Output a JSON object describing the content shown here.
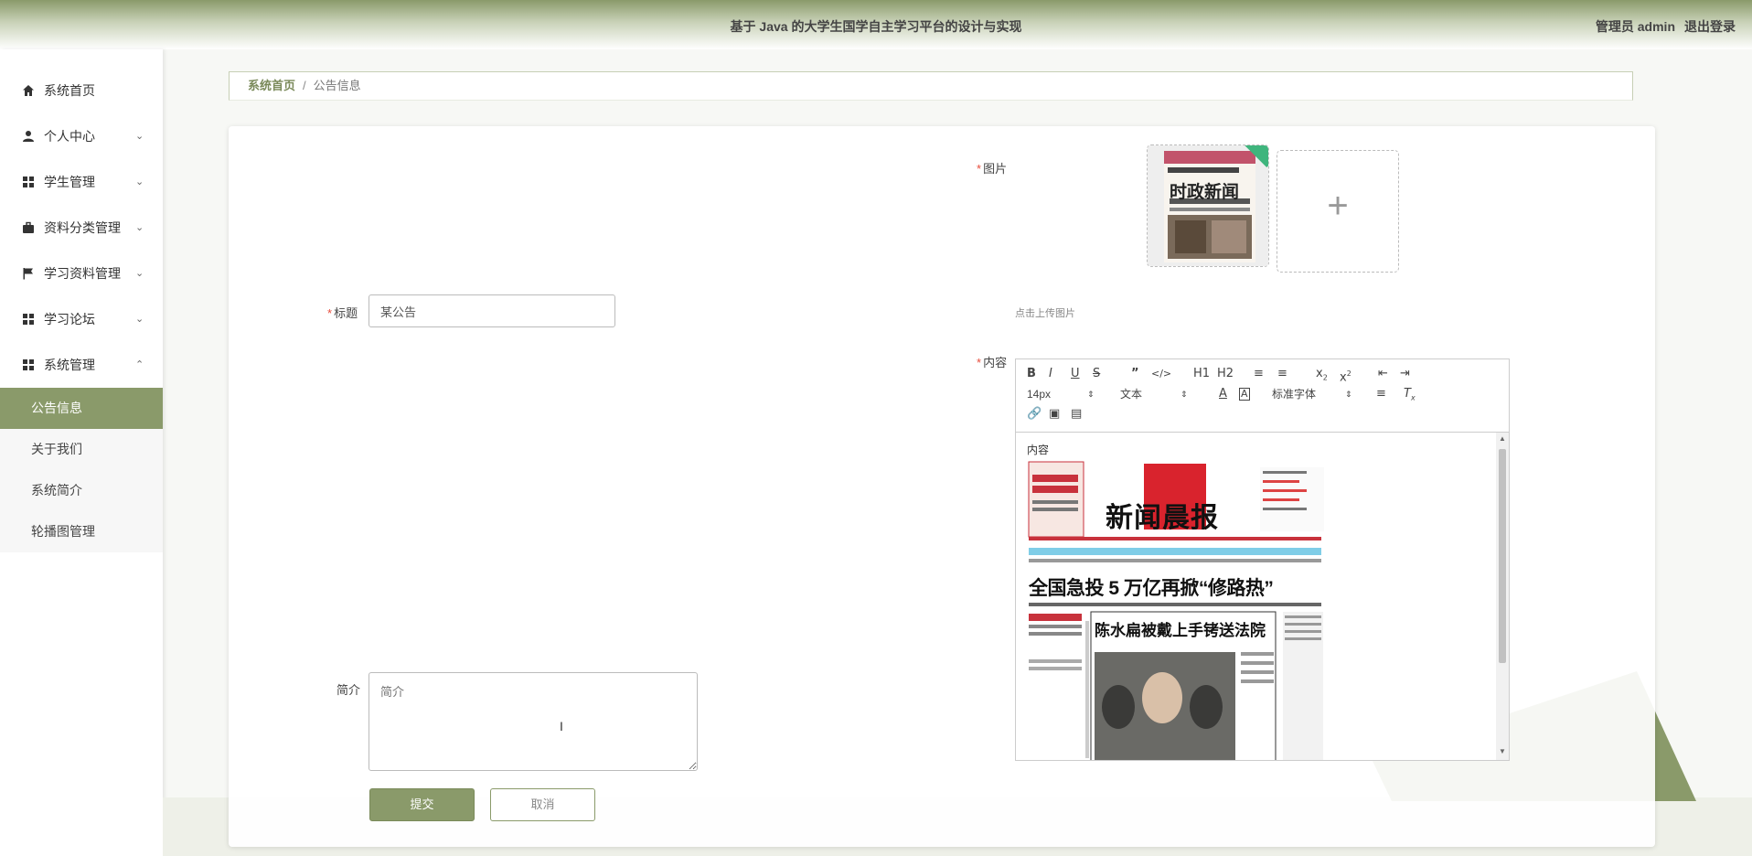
{
  "header": {
    "title": "基于 Java 的大学生国学自主学习平台的设计与实现",
    "user_label": "管理员 admin",
    "logout_label": "退出登录"
  },
  "sidebar": {
    "items": [
      {
        "label": "系统首页",
        "icon": "home-icon"
      },
      {
        "label": "个人中心",
        "icon": "user-icon",
        "expandable": true
      },
      {
        "label": "学生管理",
        "icon": "grid-icon",
        "expandable": true
      },
      {
        "label": "资料分类管理",
        "icon": "briefcase-icon",
        "expandable": true
      },
      {
        "label": "学习资料管理",
        "icon": "flag-icon",
        "expandable": true
      },
      {
        "label": "学习论坛",
        "icon": "grid-icon",
        "expandable": true
      },
      {
        "label": "系统管理",
        "icon": "grid-icon",
        "expandable": true,
        "expanded": true
      }
    ],
    "subitems": [
      {
        "label": "公告信息",
        "active": true
      },
      {
        "label": "关于我们"
      },
      {
        "label": "系统简介"
      },
      {
        "label": "轮播图管理"
      }
    ]
  },
  "breadcrumb": {
    "home": "系统首页",
    "separator": "/",
    "current": "公告信息"
  },
  "form": {
    "title_label": "标题",
    "title_value": "某公告",
    "image_label": "图片",
    "upload_hint": "点击上传图片",
    "content_label": "内容",
    "summary_label": "简介",
    "summary_placeholder": "简介",
    "submit_label": "提交",
    "cancel_label": "取消"
  },
  "editor": {
    "font_size": "14px",
    "paragraph": "文本",
    "font_family": "标准字体",
    "content_text": "内容",
    "newspaper_headline": "全国急投 5 万亿再掀“修路热”",
    "newspaper_subheadline": "陈水扁被戴上手铐送法院",
    "newspaper_masthead": "新闻晨报"
  },
  "thumbnail": {
    "text": "时政新闻"
  },
  "colors": {
    "accent": "#8a9a6a",
    "accent_dark": "#7a8a5a",
    "required": "#e74c3c"
  }
}
